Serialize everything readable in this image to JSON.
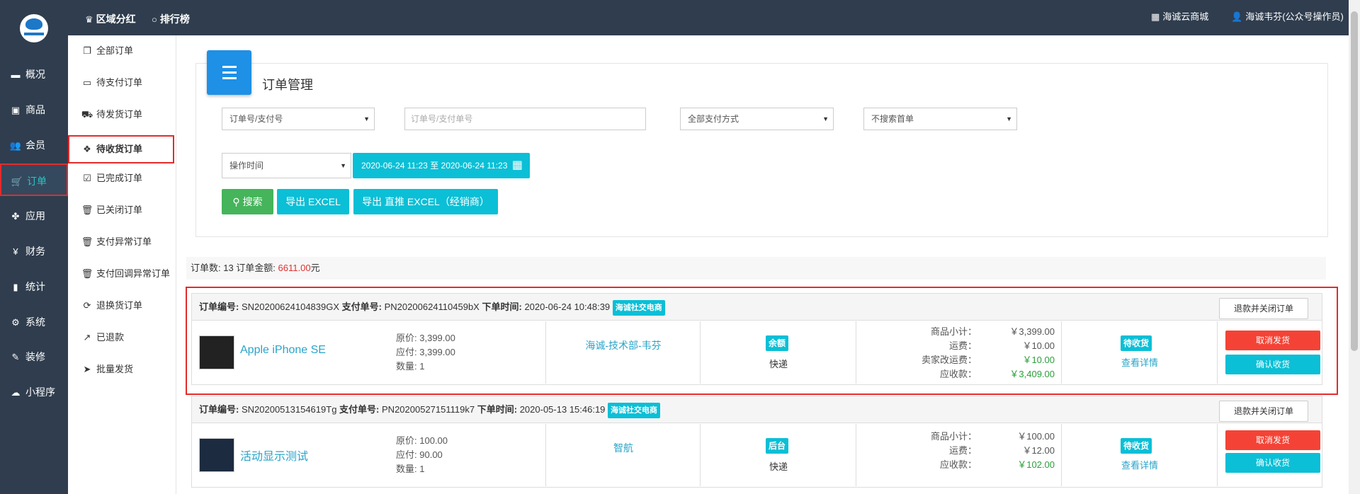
{
  "topbar": {
    "left": [
      {
        "icon": "trophy-icon",
        "label": "区域分红"
      },
      {
        "icon": "circle-icon",
        "label": "排行榜"
      }
    ],
    "right": [
      {
        "icon": "grid-icon",
        "label": "海诚云商城"
      },
      {
        "icon": "user-icon",
        "label": "海诚韦芬(公众号操作员)"
      }
    ]
  },
  "sidebar1": [
    {
      "icon": "overview-icon",
      "label": "概况"
    },
    {
      "icon": "goods-icon",
      "label": "商品"
    },
    {
      "icon": "members-icon",
      "label": "会员"
    },
    {
      "icon": "cart-icon",
      "label": "订单",
      "active": true
    },
    {
      "icon": "apps-icon",
      "label": "应用"
    },
    {
      "icon": "yen-icon",
      "label": "财务"
    },
    {
      "icon": "stats-icon",
      "label": "统计"
    },
    {
      "icon": "system-icon",
      "label": "系统"
    },
    {
      "icon": "decorate-icon",
      "label": "装修"
    },
    {
      "icon": "miniprogram-icon",
      "label": "小程序"
    }
  ],
  "sidebar2": [
    {
      "label": "全部订单"
    },
    {
      "label": "待支付订单"
    },
    {
      "label": "待发货订单"
    },
    {
      "label": "待收货订单",
      "active": true
    },
    {
      "label": "已完成订单"
    },
    {
      "label": "已关闭订单"
    },
    {
      "label": "支付异常订单"
    },
    {
      "label": "支付回调异常订单"
    },
    {
      "label": "退换货订单"
    },
    {
      "label": "已退款"
    },
    {
      "label": "批量发货"
    }
  ],
  "page": {
    "title": "订单管理"
  },
  "filters": {
    "order_type": "订单号/支付号",
    "order_input_placeholder": "订单号/支付单号",
    "pay_method": "全部支付方式",
    "first_order": "不搜索首单",
    "time_type": "操作时间",
    "date_range": "2020-06-24 11:23 至 2020-06-24 11:23"
  },
  "buttons": {
    "search": "搜索",
    "export": "导出 EXCEL",
    "export_direct": "导出 直推 EXCEL（经销商）"
  },
  "summary": {
    "prefix": "订单数: 13 订单金额: ",
    "amount": "6611.00",
    "unit": "元"
  },
  "labels": {
    "order_no": "订单编号:",
    "pay_no": "支付单号:",
    "order_time": "下单时间:",
    "subtotal": "商品小计：",
    "shipping": "运费：",
    "seller_ship": "卖家改运费：",
    "receivable": "应收款：",
    "close": "退款并关闭订单",
    "cancel": "取消发货",
    "confirm": "确认收货",
    "detail": "查看详情",
    "orig_price": "原价:",
    "due_price": "应付:",
    "qty": "数量:"
  },
  "orders": [
    {
      "order_no": "SN20200624104839GX",
      "pay_no": "PN20200624110459bX",
      "time": "2020-06-24 10:48:39",
      "shop": "海诚社交电商",
      "product": "Apple iPhone SE",
      "orig": "3,399.00",
      "due": "3,399.00",
      "qty": "1",
      "buyer": "海诚-技术部-韦芬",
      "pay": "余额",
      "ship": "快递",
      "subtotal": "￥3,399.00",
      "shipping": "￥10.00",
      "seller_ship": "￥10.00",
      "receivable": "￥3,409.00",
      "status": "待收货"
    },
    {
      "order_no": "SN20200513154619Tg",
      "pay_no": "PN20200527151119k7",
      "time": "2020-05-13 15:46:19",
      "shop": "海诚社交电商",
      "product": "活动显示测试",
      "orig": "100.00",
      "due": "90.00",
      "qty": "1",
      "buyer": "智航",
      "pay": "后台",
      "ship": "快递",
      "subtotal": "￥100.00",
      "shipping": "￥12.00",
      "receivable": "￥102.00",
      "status": "待收货"
    }
  ],
  "colors": {
    "sidebar": "#2f3d4e",
    "accent": "#0bbfd6",
    "danger": "#f44336",
    "success": "#45b45a"
  }
}
